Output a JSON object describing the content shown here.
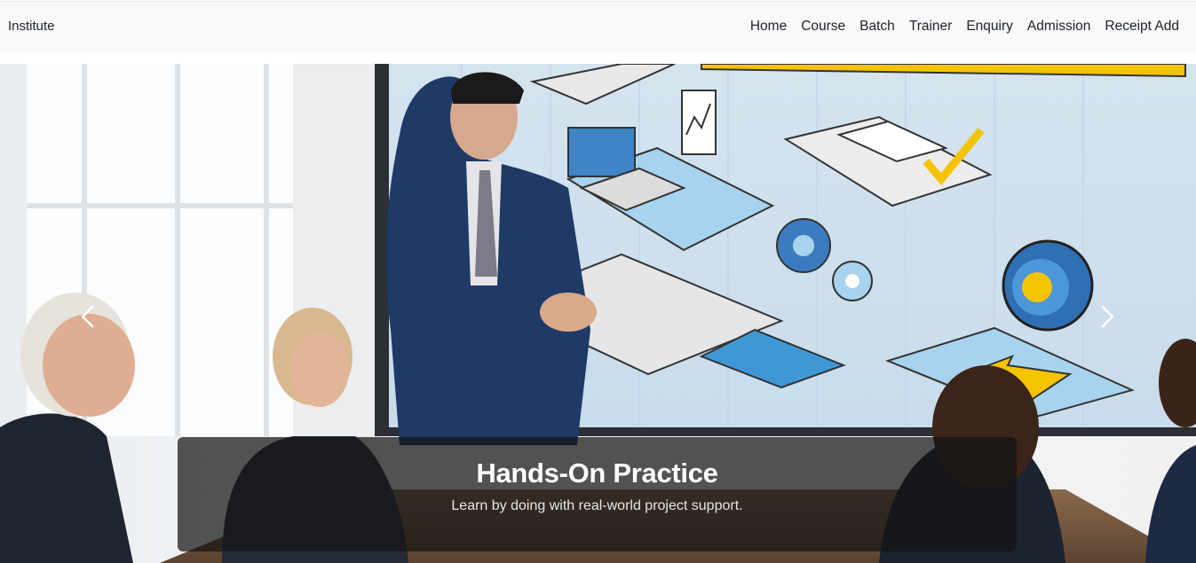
{
  "navbar": {
    "brand": "Institute",
    "links": [
      "Home",
      "Course",
      "Batch",
      "Trainer",
      "Enquiry",
      "Admission",
      "Receipt Add"
    ]
  },
  "carousel": {
    "slide": {
      "title": "Hands-On Practice",
      "text": "Learn by doing with real-world project support."
    },
    "prev_icon": "chevron-left-icon",
    "next_icon": "chevron-right-icon"
  }
}
